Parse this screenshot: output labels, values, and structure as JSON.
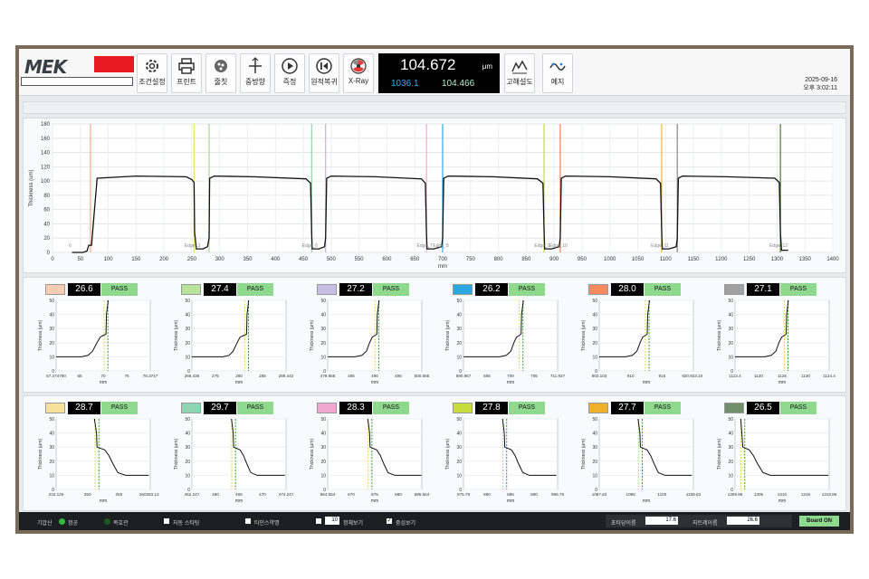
{
  "toolbar": {
    "logo": "MEK",
    "buttons": [
      {
        "label": "조건설정",
        "icon": "gear-icon"
      },
      {
        "label": "프린트",
        "icon": "printer-icon"
      },
      {
        "label": "줄칫",
        "icon": "roll-icon"
      },
      {
        "label": "중방향",
        "icon": "crosshair-icon"
      },
      {
        "label": "즉정",
        "icon": "play-icon"
      },
      {
        "label": "원적복귀",
        "icon": "skip-back-icon"
      },
      {
        "label": "X-Ray",
        "icon": "xray-icon"
      },
      {
        "label": "고해설도",
        "icon": "trend-chart-icon"
      },
      {
        "label": "예지",
        "icon": "wave-icon"
      }
    ],
    "readout": {
      "main": "104.672",
      "unit": "μm",
      "left": "1036.1",
      "right": "104.466"
    },
    "date": "2025-09-16",
    "time": "오후 3:02:11"
  },
  "main_chart": {
    "ylabel": "Thickness (um)",
    "xlabel": "mm",
    "edge_labels": [
      "6",
      "Edge_3",
      "Edge_6",
      "Edge_7",
      "Edge_8",
      "Edge_9",
      "Edge_10",
      "Edge_11",
      "Edge_12"
    ],
    "edge_colors": [
      "#f4a98a",
      "#e5e36a",
      "#a8d98a",
      "#8fd0a8",
      "#c4b3e0",
      "#f5a6c8",
      "#2da8e0",
      "#c5d93a",
      "#f47f4f",
      "#f0b429",
      "#888888",
      "#4d7a3a"
    ]
  },
  "chart_data": [
    {
      "type": "line",
      "title": "",
      "xlabel": "mm",
      "ylabel": "Thickness (um)",
      "xlim": [
        0,
        1400
      ],
      "ylim": [
        0,
        180
      ],
      "xticks": [
        0,
        50,
        100,
        150,
        200,
        250,
        300,
        350,
        400,
        450,
        500,
        550,
        600,
        650,
        700,
        750,
        800,
        850,
        900,
        950,
        1000,
        1050,
        1100,
        1150,
        1200,
        1250,
        1300,
        1350,
        1400
      ],
      "yticks": [
        0,
        20,
        40,
        60,
        80,
        100,
        120,
        140,
        160,
        180
      ],
      "grid": true,
      "edges_x": [
        68,
        254,
        281,
        465,
        490,
        671,
        700,
        882,
        911,
        1093,
        1121,
        1306
      ],
      "series": [
        {
          "x": [
            35,
            55,
            62,
            65,
            70,
            80,
            150,
            240,
            250,
            254,
            255,
            258,
            270,
            278,
            281,
            282,
            290,
            360,
            455,
            463,
            465,
            466,
            478,
            488,
            490,
            492,
            500,
            580,
            662,
            669,
            671,
            672,
            684,
            698,
            700,
            702,
            710,
            790,
            870,
            880,
            882,
            883,
            895,
            909,
            911,
            913,
            920,
            1000,
            1083,
            1091,
            1093,
            1094,
            1106,
            1119,
            1121,
            1123,
            1130,
            1210,
            1296,
            1304,
            1306,
            1308,
            1320
          ],
          "y": [
            0,
            0,
            2,
            10,
            10,
            104,
            107,
            106,
            102,
            98,
            28,
            5,
            5,
            8,
            20,
            104,
            107,
            106,
            103,
            97,
            28,
            5,
            5,
            8,
            20,
            104,
            107,
            106,
            103,
            97,
            28,
            5,
            5,
            8,
            20,
            104,
            107,
            106,
            103,
            97,
            28,
            5,
            5,
            8,
            20,
            104,
            107,
            106,
            103,
            97,
            28,
            5,
            5,
            8,
            20,
            104,
            107,
            106,
            104,
            98,
            28,
            3,
            3
          ]
        }
      ]
    },
    {
      "type": "line",
      "xlabel": "mm",
      "ylabel": "Thickness (μm)",
      "ylim": [
        0,
        50
      ],
      "xlim": [
        57.37476,
        78.3747
      ],
      "xticks": [
        "57.374760",
        "65",
        "70",
        "75",
        "78.3747"
      ],
      "rise": true,
      "series": [
        {
          "x": [
            57.4,
            63,
            64.5,
            65.5,
            66.5,
            67.2,
            67.8,
            68.5,
            68.6,
            69
          ],
          "y": [
            10,
            10,
            11,
            14,
            20,
            24,
            25,
            26,
            40,
            50
          ]
        }
      ]
    },
    {
      "type": "line",
      "xlabel": "mm",
      "ylabel": "Thickness (μm)",
      "ylim": [
        0,
        50
      ],
      "xlim": [
        266.436,
        289.442
      ],
      "xticks": [
        "266.436",
        "275",
        "280",
        "285",
        "289.442"
      ],
      "rise": true,
      "series": [
        {
          "x": [
            266.4,
            274,
            275.5,
            276.5,
            277.5,
            278.2,
            279,
            279.8,
            279.9,
            280.3
          ],
          "y": [
            10,
            10,
            11,
            14,
            20,
            24,
            25,
            26,
            40,
            50
          ]
        }
      ]
    },
    {
      "type": "line",
      "xlabel": "mm",
      "ylabel": "Thickness (μm)",
      "ylim": [
        0,
        50
      ],
      "xlim": [
        479.985,
        500.685
      ],
      "xticks": [
        "479.985",
        "485",
        "490",
        "495",
        "500.685"
      ],
      "rise": true,
      "series": [
        {
          "x": [
            480,
            486,
            487.5,
            488.5,
            489.2,
            489.8,
            490.3,
            490.8,
            490.9,
            491.3
          ],
          "y": [
            10,
            10,
            11,
            14,
            20,
            24,
            25,
            26,
            40,
            50
          ]
        }
      ]
    },
    {
      "type": "line",
      "xlabel": "mm",
      "ylabel": "Thickness (μm)",
      "ylim": [
        0,
        50
      ],
      "xlim": [
        690.967,
        711.927
      ],
      "xticks": [
        "690.967",
        "695",
        "700",
        "705",
        "711.927"
      ],
      "rise": true,
      "series": [
        {
          "x": [
            691,
            699,
            700.5,
            701.5,
            702.2,
            702.8,
            703.3,
            703.8,
            703.9,
            704.3
          ],
          "y": [
            10,
            10,
            11,
            14,
            20,
            24,
            25,
            26,
            40,
            50
          ]
        }
      ]
    },
    {
      "type": "line",
      "xlabel": "mm",
      "ylabel": "Thickness (μm)",
      "ylim": [
        0,
        50
      ],
      "xlim": [
        902.103,
        923.103
      ],
      "xticks": [
        "902.103",
        "910",
        "915",
        "920.923.103"
      ],
      "rise": true,
      "series": [
        {
          "x": [
            902.1,
            908,
            909.5,
            910.5,
            911.2,
            911.8,
            912.3,
            912.8,
            912.9,
            913.3
          ],
          "y": [
            10,
            10,
            11,
            14,
            20,
            24,
            25,
            26,
            40,
            50
          ]
        }
      ]
    },
    {
      "type": "line",
      "xlabel": "mm",
      "ylabel": "Thickness (μm)",
      "ylim": [
        0,
        50
      ],
      "xlim": [
        1113.4,
        1134.4
      ],
      "xticks": [
        "1113.4",
        "1120",
        "1125",
        "1130",
        "1134.4"
      ],
      "rise": true,
      "series": [
        {
          "x": [
            1113.4,
            1120,
            1121.5,
            1122.5,
            1123.2,
            1123.8,
            1124.3,
            1124.8,
            1124.9,
            1125.3
          ],
          "y": [
            10,
            10,
            11,
            14,
            20,
            24,
            25,
            26,
            40,
            50
          ]
        }
      ]
    },
    {
      "type": "line",
      "xlabel": "mm",
      "ylabel": "Thickness (μm)",
      "ylim": [
        0,
        50
      ],
      "xlim": [
        242.125,
        260.263
      ],
      "xticks": [
        "242.125",
        "250",
        "255",
        "260263.125"
      ],
      "rise": false,
      "series": [
        {
          "x": [
            249.5,
            249.9,
            250,
            250.8,
            251.5,
            252.3,
            253.1,
            254,
            255.5,
            260
          ],
          "y": [
            50,
            40,
            30,
            29,
            28,
            24,
            18,
            12,
            10,
            10
          ]
        }
      ]
    },
    {
      "type": "line",
      "xlabel": "mm",
      "ylabel": "Thickness (μm)",
      "ylim": [
        0,
        50
      ],
      "xlim": [
        452.247,
        474.247
      ],
      "xticks": [
        "452.247",
        "460",
        "465",
        "470",
        "474.247"
      ],
      "rise": false,
      "series": [
        {
          "x": [
            461.5,
            461.9,
            462,
            462.8,
            463.5,
            464.3,
            465.1,
            466,
            467.5,
            474
          ],
          "y": [
            50,
            40,
            30,
            29,
            28,
            24,
            18,
            12,
            10,
            10
          ]
        }
      ]
    },
    {
      "type": "line",
      "xlabel": "mm",
      "ylabel": "Thickness (μm)",
      "ylim": [
        0,
        50
      ],
      "xlim": [
        664.554,
        685.554
      ],
      "xticks": [
        "664.554",
        "670",
        "675",
        "680",
        "685.554"
      ],
      "rise": false,
      "series": [
        {
          "x": [
            673.5,
            673.9,
            674,
            674.8,
            675.5,
            676.3,
            677.1,
            678,
            679.5,
            685.5
          ],
          "y": [
            50,
            40,
            30,
            29,
            28,
            24,
            18,
            12,
            10,
            10
          ]
        }
      ]
    },
    {
      "type": "line",
      "xlabel": "mm",
      "ylabel": "Thickness (μm)",
      "ylim": [
        0,
        50
      ],
      "xlim": [
        875.79,
        896.78
      ],
      "xticks": [
        "875.79",
        "880",
        "885",
        "890",
        "896.78"
      ],
      "rise": false,
      "series": [
        {
          "x": [
            884.5,
            884.9,
            885,
            885.8,
            886.5,
            887.3,
            888.1,
            889,
            890.5,
            896.5
          ],
          "y": [
            50,
            40,
            30,
            29,
            28,
            24,
            18,
            12,
            10,
            10
          ]
        }
      ]
    },
    {
      "type": "line",
      "xlabel": "mm",
      "ylabel": "Thickness (μm)",
      "ylim": [
        0,
        50
      ],
      "xlim": [
        1087.83,
        1108.83
      ],
      "xticks": [
        "1087.83",
        "1095",
        "1100",
        "1108.83"
      ],
      "rise": false,
      "series": [
        {
          "x": [
            1096.5,
            1096.9,
            1097,
            1097.8,
            1098.5,
            1099.3,
            1100.1,
            1101,
            1102.5,
            1108.5
          ],
          "y": [
            50,
            40,
            30,
            29,
            28,
            24,
            18,
            12,
            10,
            10
          ]
        }
      ]
    },
    {
      "type": "line",
      "xlabel": "mm",
      "ylabel": "Thickness (μm)",
      "ylim": [
        0,
        50
      ],
      "xlim": [
        1309.96,
        1318.86
      ],
      "xticks": [
        "1309.96",
        "1305",
        "1310",
        "1315",
        "1318.86"
      ],
      "rise": false,
      "series": [
        {
          "x": [
            1310.5,
            1310.6,
            1310.7,
            1311,
            1311.3,
            1311.7,
            1312.1,
            1312.6,
            1313.3,
            1318.8
          ],
          "y": [
            50,
            40,
            30,
            29,
            28,
            24,
            18,
            12,
            10,
            10
          ]
        }
      ]
    }
  ],
  "zones": [
    {
      "value": "26.6",
      "status": "PASS",
      "color": "#f9cdb3"
    },
    {
      "value": "27.4",
      "status": "PASS",
      "color": "#b8e39a"
    },
    {
      "value": "27.2",
      "status": "PASS",
      "color": "#c8bde3"
    },
    {
      "value": "26.2",
      "status": "PASS",
      "color": "#2aa7e0"
    },
    {
      "value": "28.0",
      "status": "PASS",
      "color": "#f58a5e"
    },
    {
      "value": "27.1",
      "status": "PASS",
      "color": "#a0a0a0"
    },
    {
      "value": "28.7",
      "status": "PASS",
      "color": "#f7e19a"
    },
    {
      "value": "29.7",
      "status": "PASS",
      "color": "#8ed6b3"
    },
    {
      "value": "28.3",
      "status": "PASS",
      "color": "#f0a8d0"
    },
    {
      "value": "27.8",
      "status": "PASS",
      "color": "#c8dc3c"
    },
    {
      "value": "27.7",
      "status": "PASS",
      "color": "#efb02e"
    },
    {
      "value": "26.5",
      "status": "PASS",
      "color": "#6f8f6a"
    }
  ],
  "status_bar": {
    "label_gaesan": "기압산",
    "label_normal": "정공",
    "label_return": "복호관",
    "check_auto": "자동 스타팅",
    "check_tab": "타인스약명",
    "count_value": "10",
    "count_label": "정체보기",
    "check_point": "중심보기",
    "start_label": "초타당이름",
    "start_value": "17.6",
    "end_label": "지트레이름",
    "end_value": "26.6",
    "board": "Board ON"
  }
}
